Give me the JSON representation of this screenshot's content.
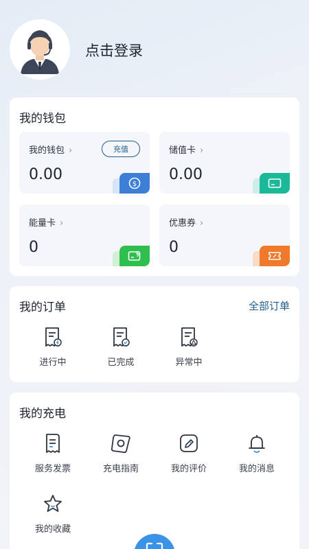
{
  "header": {
    "login_text": "点击登录"
  },
  "wallet": {
    "title": "我的钱包",
    "recharge_label": "充值",
    "tiles": [
      {
        "label": "我的钱包",
        "value": "0.00",
        "icon": "dollar-coin-icon",
        "color": "#3d7fd6"
      },
      {
        "label": "储值卡",
        "value": "0.00",
        "icon": "card-icon",
        "color": "#1cb89a"
      },
      {
        "label": "能量卡",
        "value": "0",
        "icon": "energy-card-icon",
        "color": "#2fbf4f"
      },
      {
        "label": "优惠券",
        "value": "0",
        "icon": "coupon-icon",
        "color": "#f07a2c"
      }
    ]
  },
  "orders": {
    "title": "我的订单",
    "all_label": "全部订单",
    "items": [
      {
        "label": "进行中",
        "icon": "order-in-progress-icon"
      },
      {
        "label": "已完成",
        "icon": "order-completed-icon"
      },
      {
        "label": "异常中",
        "icon": "order-exception-icon"
      }
    ]
  },
  "charging": {
    "title": "我的充电",
    "items": [
      {
        "label": "服务发票",
        "icon": "invoice-icon"
      },
      {
        "label": "充电指南",
        "icon": "guide-icon"
      },
      {
        "label": "我的评价",
        "icon": "review-pen-icon"
      },
      {
        "label": "我的消息",
        "icon": "bell-icon"
      },
      {
        "label": "我的收藏",
        "icon": "star-icon"
      }
    ]
  },
  "colors": {
    "accent": "#1f5e8a",
    "fab": "#3a93e6"
  }
}
